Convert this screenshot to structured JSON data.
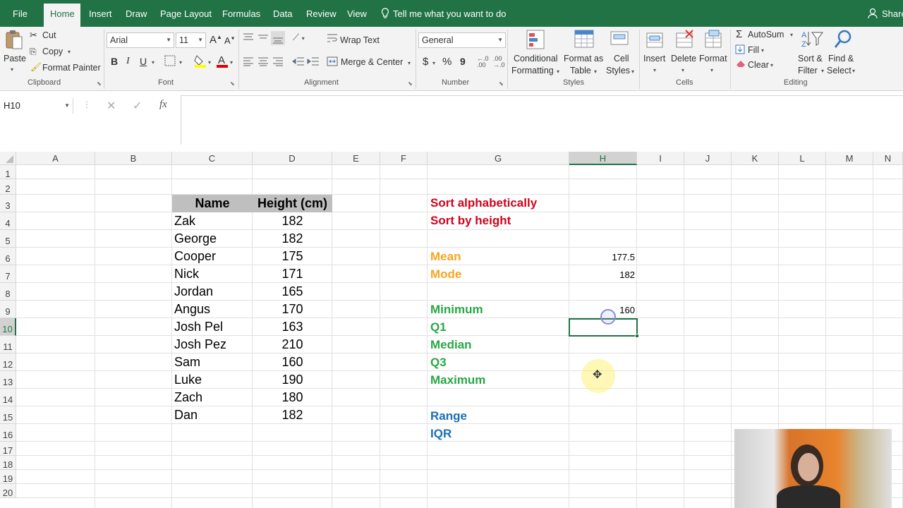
{
  "menu": {
    "file": "File",
    "home": "Home",
    "insert": "Insert",
    "draw": "Draw",
    "page_layout": "Page Layout",
    "formulas": "Formulas",
    "data": "Data",
    "review": "Review",
    "view": "View",
    "tell_me": "Tell me what you want to do",
    "share": "Share"
  },
  "ribbon": {
    "clipboard": {
      "paste": "Paste",
      "cut": "Cut",
      "copy": "Copy",
      "format_painter": "Format Painter",
      "group": "Clipboard"
    },
    "font": {
      "name": "Arial",
      "size": "11",
      "bold": "B",
      "italic": "I",
      "underline": "U",
      "group": "Font"
    },
    "alignment": {
      "wrap_text": "Wrap Text",
      "merge_center": "Merge & Center",
      "group": "Alignment"
    },
    "number": {
      "format": "General",
      "currency": "$",
      "percent": "%",
      "comma": "9",
      "group": "Number"
    },
    "styles": {
      "conditional_1": "Conditional",
      "conditional_2": "Formatting",
      "format_table_1": "Format as",
      "format_table_2": "Table",
      "cell_styles_1": "Cell",
      "cell_styles_2": "Styles",
      "group": "Styles"
    },
    "cells": {
      "insert": "Insert",
      "delete": "Delete",
      "format": "Format",
      "group": "Cells"
    },
    "editing": {
      "autosum": "AutoSum",
      "fill": "Fill",
      "clear": "Clear",
      "sort_1": "Sort &",
      "sort_2": "Filter",
      "find_1": "Find &",
      "find_2": "Select",
      "group": "Editing"
    }
  },
  "formula_bar": {
    "name_box": "H10",
    "fx": "fx",
    "value": ""
  },
  "columns": [
    "A",
    "B",
    "C",
    "D",
    "E",
    "F",
    "G",
    "H",
    "I",
    "J",
    "K",
    "L",
    "M",
    "N"
  ],
  "rows": [
    "1",
    "2",
    "3",
    "4",
    "5",
    "6",
    "7",
    "8",
    "9",
    "10",
    "11",
    "12",
    "13",
    "14",
    "15",
    "16",
    "17",
    "18",
    "19",
    "20"
  ],
  "table": {
    "header_name": "Name",
    "header_height": "Height (cm)",
    "names": [
      "Zak",
      "George",
      "Cooper",
      "Nick",
      "Jordan",
      "Angus",
      "Josh Pel",
      "Josh Pez",
      "Sam",
      "Luke",
      "Zach",
      "Dan"
    ],
    "heights": [
      "182",
      "182",
      "175",
      "171",
      "165",
      "170",
      "163",
      "210",
      "160",
      "190",
      "180",
      "182"
    ]
  },
  "tasks": {
    "sort_alpha": "Sort alphabetically",
    "sort_height": "Sort by height",
    "mean": "Mean",
    "mode": "Mode",
    "minimum": "Minimum",
    "q1": "Q1",
    "median": "Median",
    "q3": "Q3",
    "maximum": "Maximum",
    "range": "Range",
    "iqr": "IQR"
  },
  "results": {
    "mean": "177.5",
    "mode": "182",
    "minimum": "160"
  },
  "colors": {
    "excel_green": "#217346",
    "red": "#d0021b",
    "orange": "#f5a623",
    "green": "#27a745",
    "blue": "#1a6fb5"
  },
  "selected_cell": "H10"
}
